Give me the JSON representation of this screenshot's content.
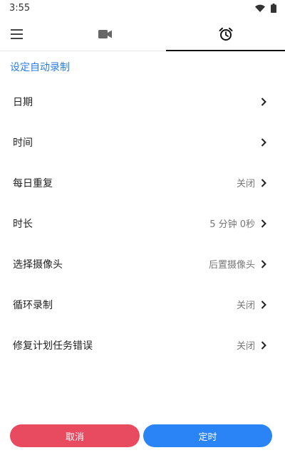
{
  "status_bar": {
    "time": "3:55",
    "icons": [
      "wifi-icon",
      "battery-icon"
    ]
  },
  "toolbar": {
    "menu_icon": "menu-icon",
    "tabs": [
      {
        "icon": "video-camera-icon",
        "selected": false
      },
      {
        "icon": "alarm-clock-icon",
        "selected": true
      }
    ]
  },
  "section": {
    "title": "设定自动录制"
  },
  "settings": [
    {
      "label": "日期",
      "value": ""
    },
    {
      "label": "时间",
      "value": ""
    },
    {
      "label": "每日重复",
      "value": "关闭"
    },
    {
      "label": "时长",
      "value": "5 分钟 0秒"
    },
    {
      "label": "选择摄像头",
      "value": "后置摄像头"
    },
    {
      "label": "循环录制",
      "value": "关闭"
    },
    {
      "label": "修复计划任务错误",
      "value": "关闭"
    }
  ],
  "buttons": {
    "cancel": "取消",
    "confirm": "定时"
  },
  "colors": {
    "accent": "#2a7fe6",
    "cancel": "#e84a5f",
    "confirm": "#2a84f6"
  }
}
